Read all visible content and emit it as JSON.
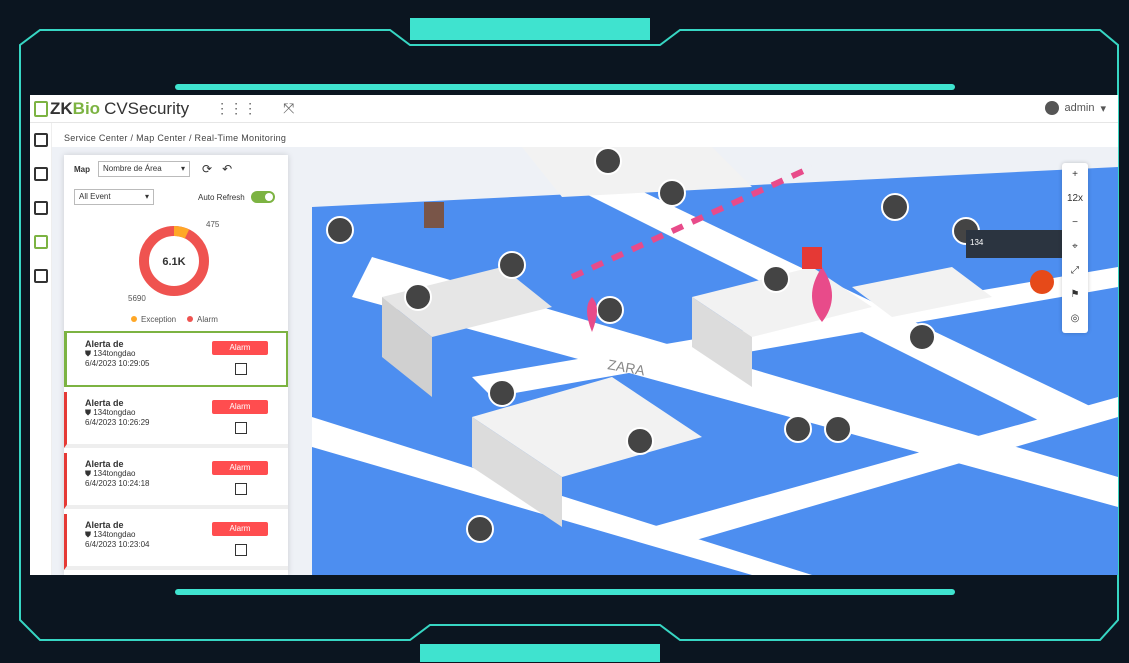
{
  "app": {
    "brand_zk": "ZK",
    "brand_bio": "Bio",
    "brand_product": "CVSecurity",
    "user": "admin"
  },
  "breadcrumb": "Service Center / Map Center / Real-Time Monitoring",
  "panel": {
    "map_label": "Map",
    "map_select": "Nombre de Área",
    "event_select": "All Event",
    "auto_refresh_label": "Auto Refresh",
    "donut_center": "6.1K",
    "donut_top_value": "475",
    "donut_bottom_value": "5690",
    "legend_exception": "Exception",
    "legend_alarm": "Alarm",
    "colors": {
      "exception": "#ffa726",
      "alarm": "#ef5350"
    }
  },
  "alarms": [
    {
      "title": "Alerta de",
      "device": "134tongdao",
      "time": "6/4/2023 10:29:05",
      "button": "Alarm"
    },
    {
      "title": "Alerta de",
      "device": "134tongdao",
      "time": "6/4/2023 10:26:29",
      "button": "Alarm"
    },
    {
      "title": "Alerta de",
      "device": "134tongdao",
      "time": "6/4/2023 10:24:18",
      "button": "Alarm"
    },
    {
      "title": "Alerta de",
      "device": "134tongdao",
      "time": "6/4/2023 10:23:04",
      "button": "Alarm"
    }
  ],
  "map": {
    "zoom": "12x",
    "tooltip": "134",
    "store_label": "ZARA",
    "zoom_in": "+",
    "zoom_out": "−"
  }
}
